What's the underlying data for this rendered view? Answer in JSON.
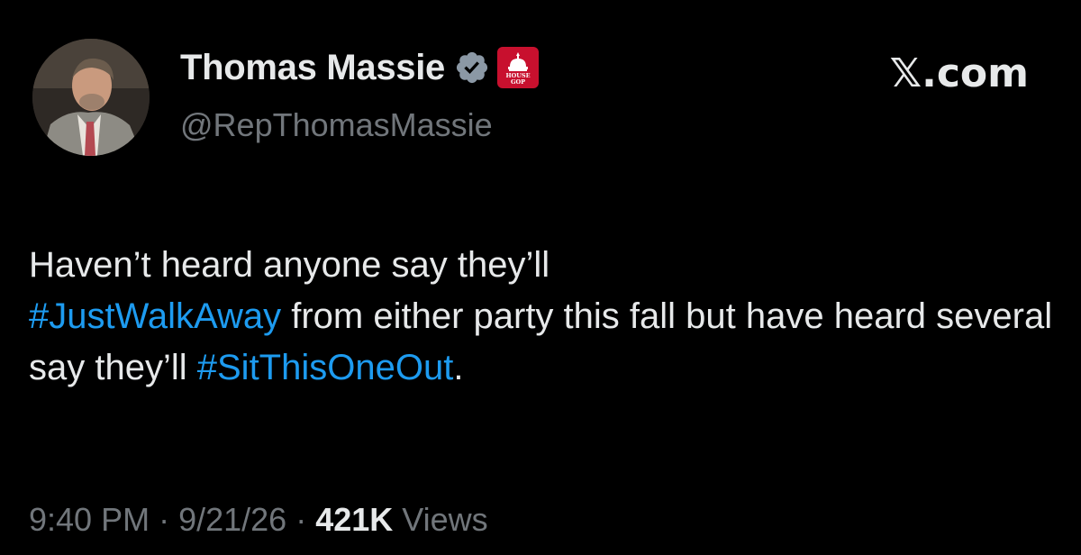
{
  "author": {
    "name": "Thomas Massie",
    "handle": "@RepThomasMassie",
    "affiliation_badge_text": [
      "HOUSE",
      "GOP"
    ],
    "verified_color": "#8b98a5",
    "affiliation_color": "#c8102e"
  },
  "brand": {
    "label": "𝕏.com"
  },
  "tweet": {
    "part1": "Haven’t heard anyone say they’ll",
    "hashtag1": "#JustWalkAway",
    "part2": " from either party this fall but have heard several say they’ll ",
    "hashtag2": "#SitThisOneOut",
    "part3": ".",
    "hashtag_color": "#1d9bf0"
  },
  "meta": {
    "time": "9:40 PM",
    "sep1": " · ",
    "date": "9/21/26",
    "sep2": " · ",
    "views_count": "421K",
    "views_label": " Views"
  },
  "icons": {
    "verified": "verified-badge-icon",
    "affiliation": "house-gop-affiliation-icon",
    "avatar": "profile-photo"
  }
}
